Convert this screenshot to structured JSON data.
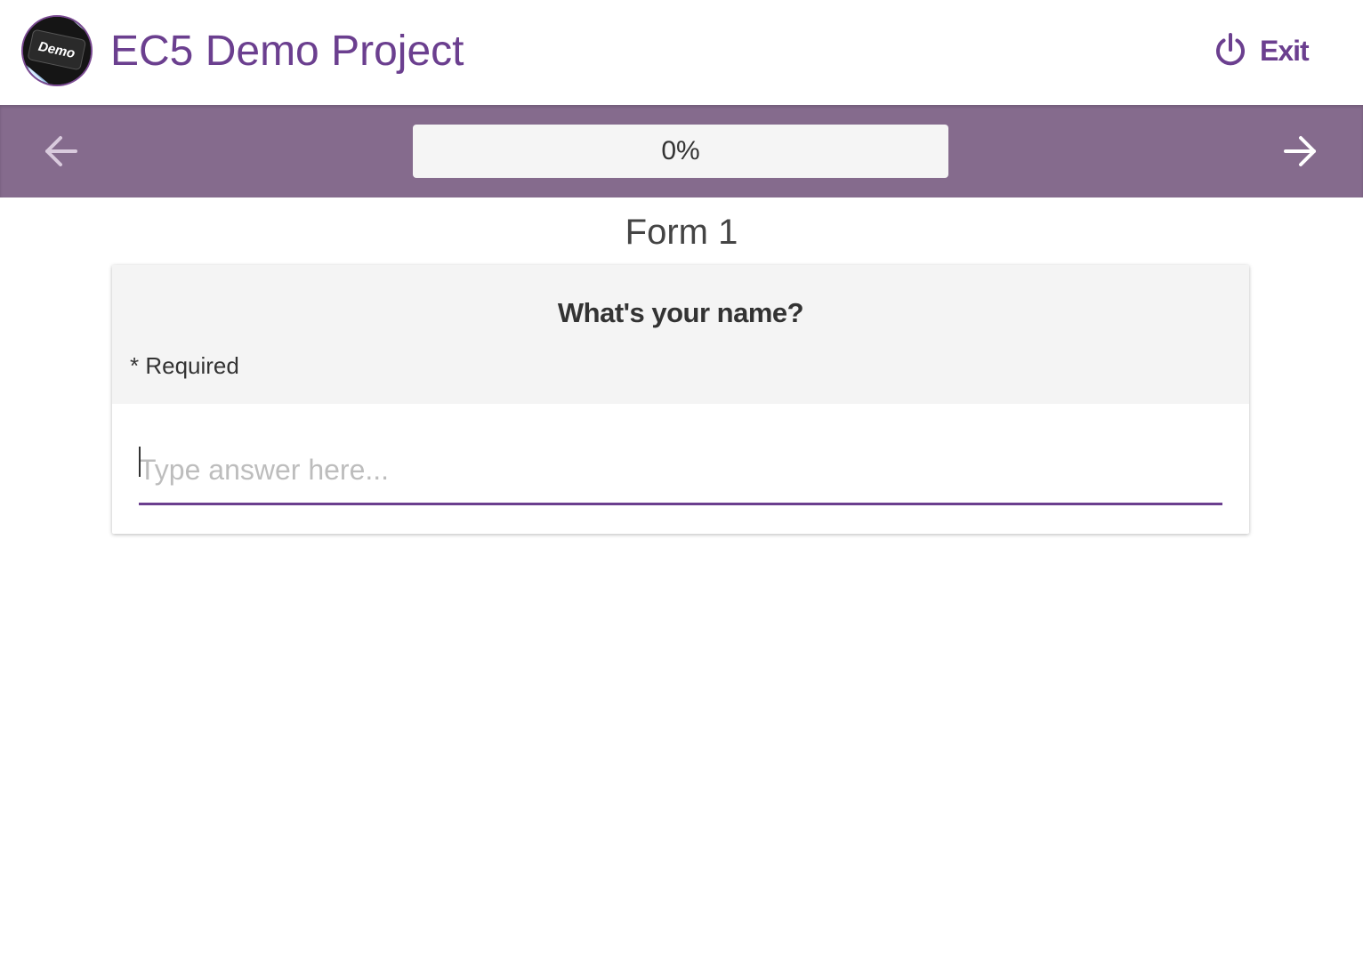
{
  "header": {
    "logo_text": "Demo",
    "project_title": "EC5 Demo Project",
    "exit_label": "Exit"
  },
  "nav": {
    "progress_text": "0%",
    "progress_value": 0
  },
  "form": {
    "title": "Form 1",
    "question": "What's your name?",
    "required_label": "* Required",
    "answer_placeholder": "Type answer here...",
    "answer_value": ""
  },
  "colors": {
    "brand": "#6b3f8f",
    "navbar": "#856b8d"
  }
}
